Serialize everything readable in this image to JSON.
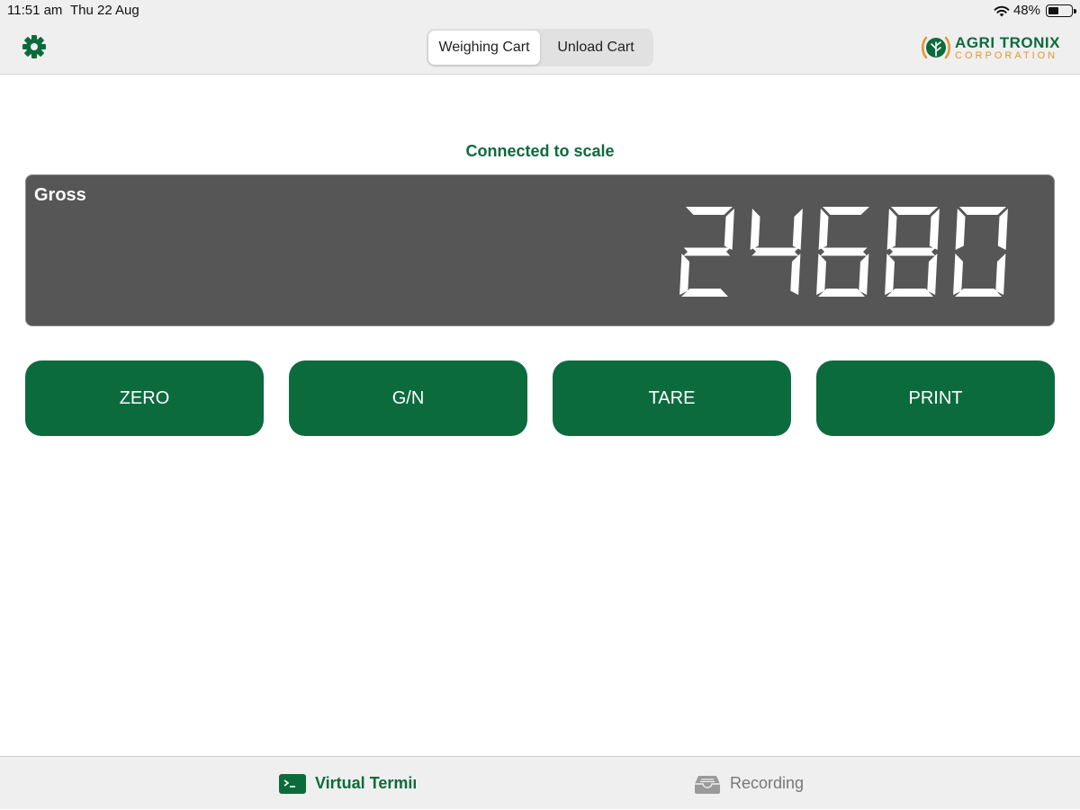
{
  "status_bar": {
    "time": "11:51 am",
    "date": "Thu 22 Aug",
    "battery": "48%",
    "battery_level": 0.48
  },
  "nav": {
    "segments": [
      {
        "label": "Weighing Cart",
        "active": true
      },
      {
        "label": "Unload Cart",
        "active": false
      }
    ],
    "brand": {
      "main": "AGRI TRONIX",
      "sub": "CORPORATION"
    }
  },
  "connection_status": "Connected to scale",
  "display": {
    "label": "Gross",
    "value": "24680"
  },
  "buttons": {
    "zero": "ZERO",
    "gn": "G/N",
    "tare": "TARE",
    "print": "PRINT"
  },
  "tabs": [
    {
      "label": "Virtual Terminal",
      "icon": "terminal-icon",
      "active": true
    },
    {
      "label": "Recording",
      "icon": "tray-icon",
      "active": false
    }
  ],
  "colors": {
    "accent": "#0c6b3d",
    "display_bg": "#565656",
    "brand_orange": "#e3962f"
  }
}
